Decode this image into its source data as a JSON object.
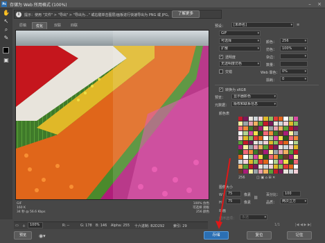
{
  "window": {
    "title": "存储为 Web 所用格式 (100%)"
  },
  "hint": {
    "label": "提示：",
    "text": "使用 \"文件\" > \"导出\" > \"导出为...\" 或右键单击图层/画板进行快速导出为 PNG 或 JPG。",
    "learn_more": "了解更多"
  },
  "tabs": [
    "原稿",
    "优化",
    "双联",
    "四联"
  ],
  "preview_info": {
    "left": [
      "GIF",
      "160 K",
      "34 秒 @ 56.6 Kbps"
    ],
    "right": [
      "100% 仿色",
      "可选择 调板",
      "256 颜色"
    ]
  },
  "status": {
    "zoom": "100%",
    "r": "R: --",
    "g": "G: 178",
    "b": "B: 146",
    "alpha": "Alpha: 255",
    "hex": "十六进制: B2D292",
    "index": "索引: 29"
  },
  "right": {
    "preset_label": "预设：",
    "preset_value": "[未命名]",
    "format": "GIF",
    "reduction": "可选择",
    "reduction_label": "颜色：",
    "colors": "256",
    "dither_algo": "扩散",
    "dither_label": "仿色：",
    "dither": "100%",
    "transparency": "透明度",
    "matte_label": "杂边：",
    "transp_dither": "无透明度仿色",
    "amount_label": "数量：",
    "interlaced": "交错",
    "websnap_label": "Web 靠色：",
    "websnap": "0%",
    "lossy_label": "损耗：",
    "lossy": "0",
    "convert_srgb": "转换为 sRGB",
    "preview_label": "预览：",
    "preview_value": "显示器颜色",
    "metadata_label": "元数据：",
    "metadata_value": "版权和联系信息",
    "color_table_label": "颜色表",
    "color_count": "256",
    "image_size_label": "图像大小",
    "w_label": "W：",
    "w_value": "75",
    "h_label": "H：",
    "h_value": "75",
    "unit": "像素",
    "percent_label": "百分比：",
    "percent": "100",
    "quality_label": "品质：",
    "quality": "两次立方",
    "animation_label": "动画",
    "loop_label": "循环选项：",
    "loop_value": "永远",
    "frame": "1/1"
  },
  "buttons": {
    "preview": "预览",
    "save": "存储",
    "reset": "复位",
    "remember": "记住",
    "done": "完成"
  }
}
